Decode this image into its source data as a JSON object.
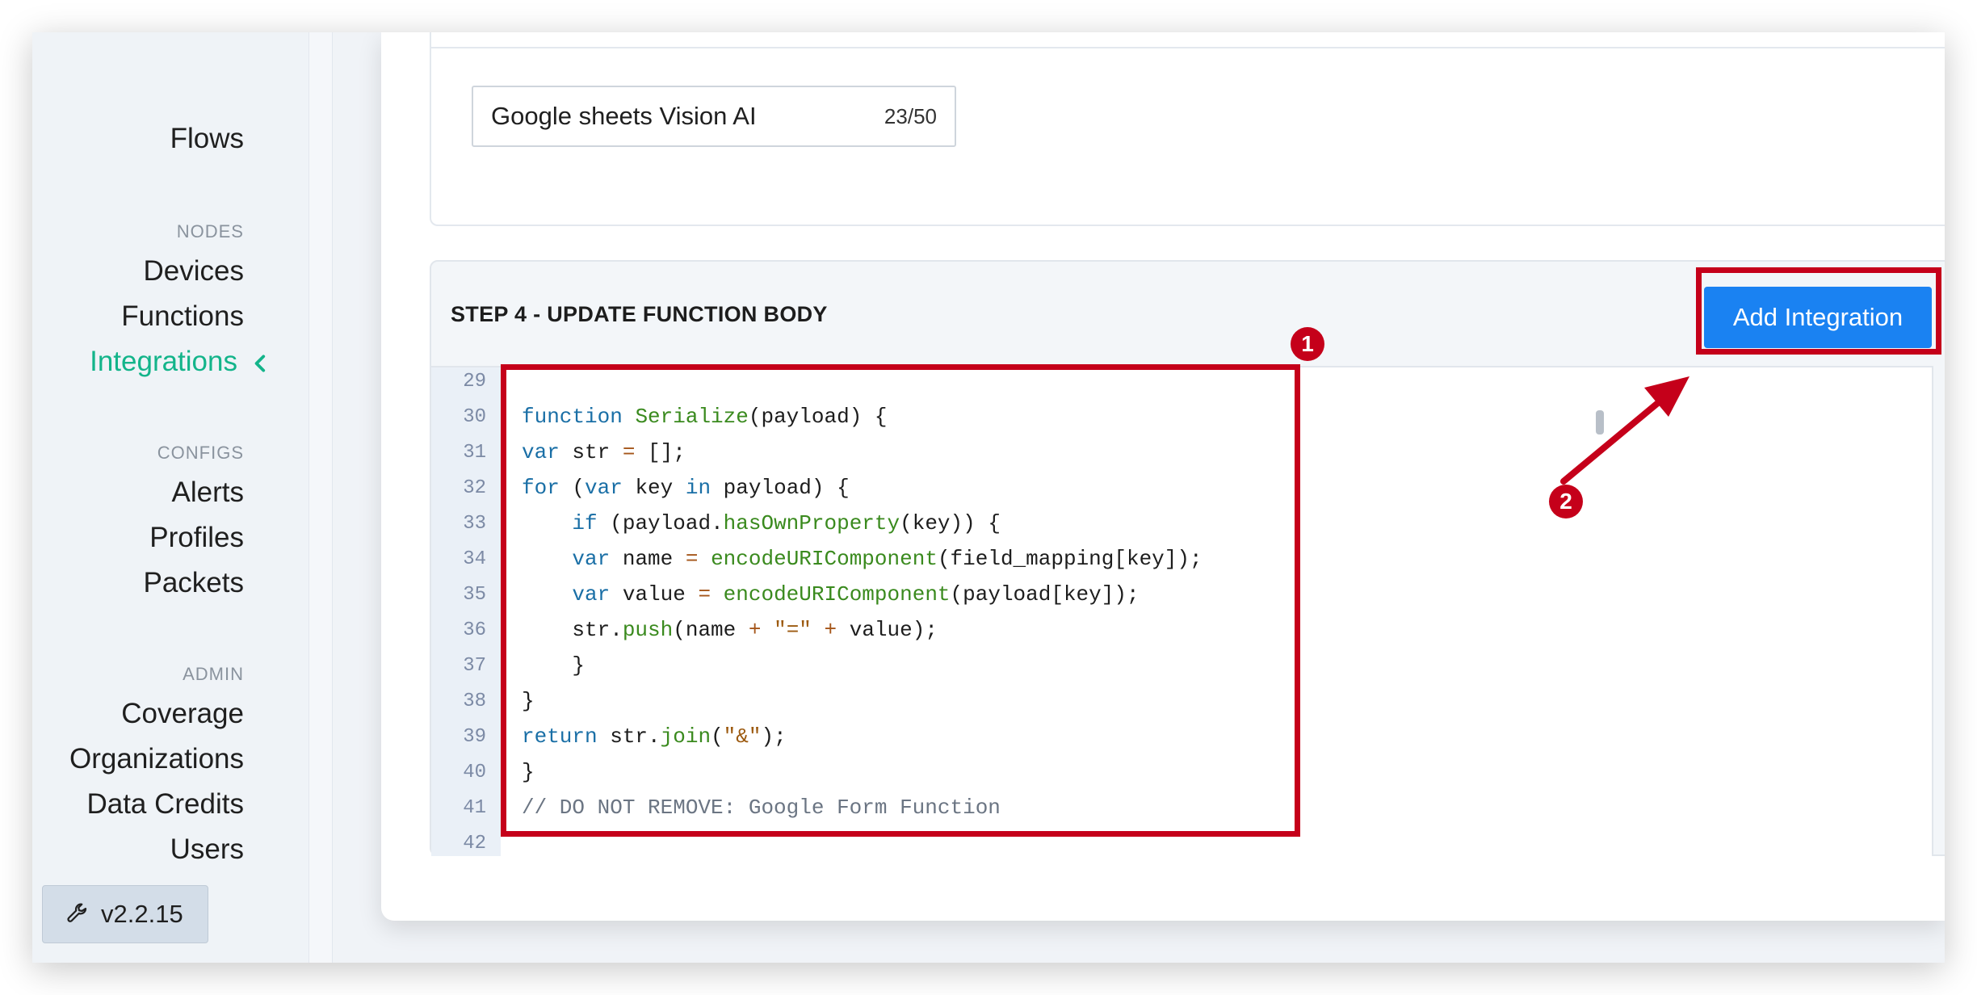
{
  "sidebar": {
    "flows": "Flows",
    "nodes_header": "NODES",
    "devices": "Devices",
    "functions": "Functions",
    "integrations": "Integrations",
    "configs_header": "CONFIGS",
    "alerts": "Alerts",
    "profiles": "Profiles",
    "packets": "Packets",
    "admin_header": "ADMIN",
    "coverage": "Coverage",
    "organizations": "Organizations",
    "data_credits": "Data Credits",
    "users": "Users",
    "version": "v2.2.15",
    "active_color": "#13b48a"
  },
  "name_field": {
    "value": "Google sheets Vision AI",
    "counter": "23/50"
  },
  "step4": {
    "title": "STEP 4 - UPDATE FUNCTION BODY",
    "add_button": "Add Integration",
    "button_color": "#1a82f2"
  },
  "code": {
    "line_numbers": [
      "29",
      "30",
      "31",
      "32",
      "33",
      "34",
      "35",
      "36",
      "37",
      "38",
      "39",
      "40",
      "41",
      "42"
    ]
  },
  "annotations": {
    "badge1": "1",
    "badge2": "2",
    "color": "#c5001a"
  }
}
